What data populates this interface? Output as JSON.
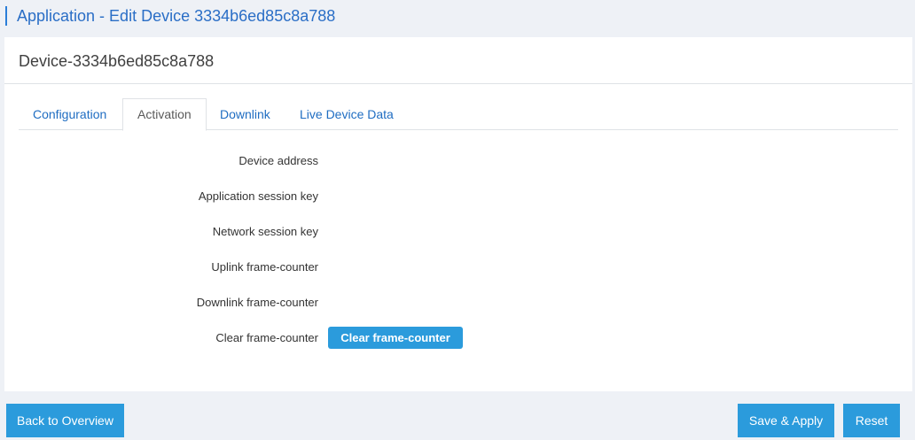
{
  "header": {
    "title": "Application - Edit Device 3334b6ed85c8a788"
  },
  "panel": {
    "title": "Device-3334b6ed85c8a788"
  },
  "tabs": [
    {
      "label": "Configuration",
      "active": false
    },
    {
      "label": "Activation",
      "active": true
    },
    {
      "label": "Downlink",
      "active": false
    },
    {
      "label": "Live Device Data",
      "active": false
    }
  ],
  "form": {
    "device_address": "Device address",
    "app_session_key": "Application session key",
    "network_session_key": "Network session key",
    "uplink_counter": "Uplink frame-counter",
    "downlink_counter": "Downlink frame-counter",
    "clear_counter": "Clear frame-counter",
    "clear_button": "Clear frame-counter"
  },
  "footer": {
    "back_label": "Back to Overview",
    "save_label": "Save & Apply",
    "reset_label": "Reset"
  },
  "colors": {
    "accent": "#2b9bdc",
    "link": "#1f6dc2",
    "background": "#eef1f6"
  }
}
